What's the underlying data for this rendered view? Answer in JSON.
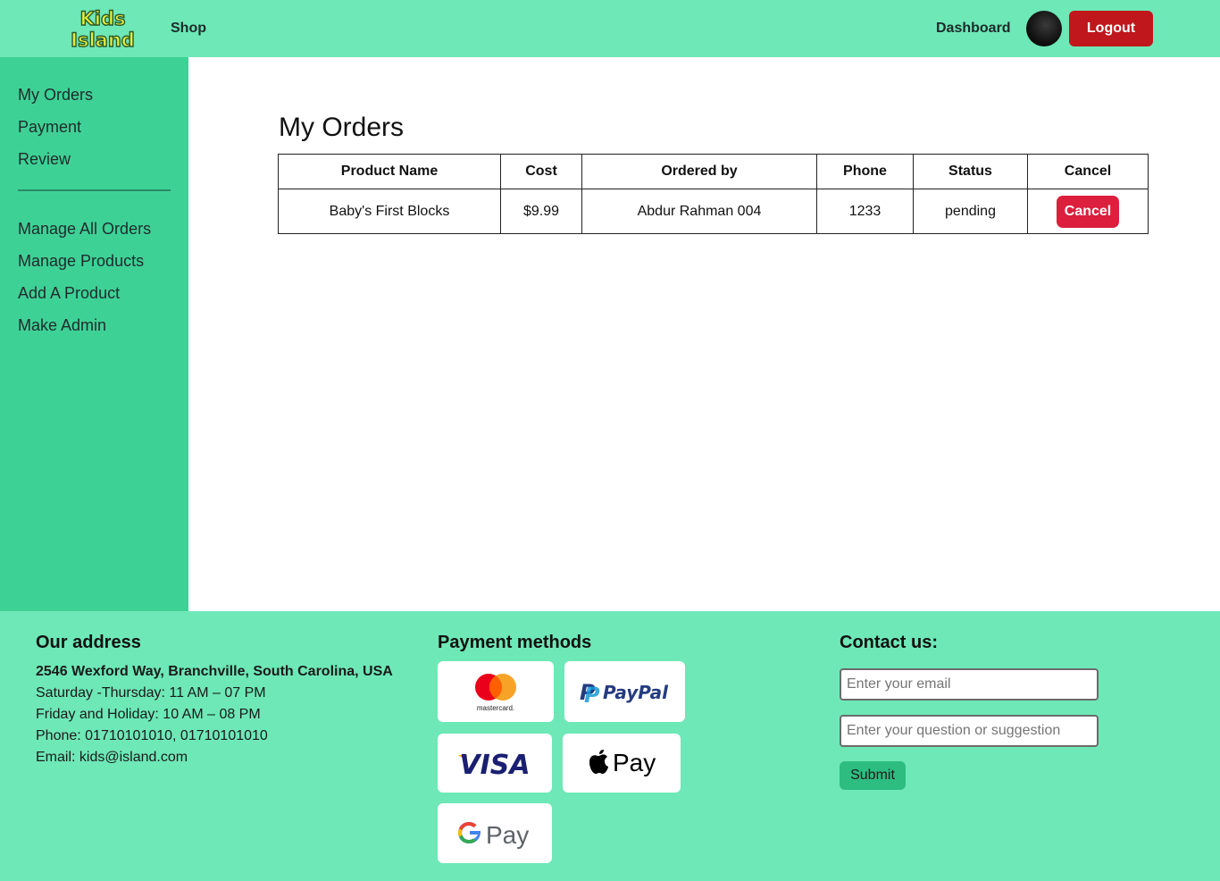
{
  "header": {
    "logo_line1": "Kids",
    "logo_line2": "Island",
    "shop_label": "Shop",
    "dashboard_label": "Dashboard",
    "logout_label": "Logout"
  },
  "sidebar": {
    "items": [
      {
        "label": "My Orders"
      },
      {
        "label": "Payment"
      },
      {
        "label": "Review"
      },
      {
        "label": "Manage All Orders"
      },
      {
        "label": "Manage Products"
      },
      {
        "label": "Add A Product"
      },
      {
        "label": "Make Admin"
      }
    ]
  },
  "main": {
    "title": "My Orders",
    "table": {
      "columns": [
        "Product Name",
        "Cost",
        "Ordered by",
        "Phone",
        "Status",
        "Cancel"
      ],
      "rows": [
        {
          "product": "Baby's First Blocks",
          "cost": "$9.99",
          "ordered_by": "Abdur Rahman 004",
          "phone": "1233",
          "status": "pending",
          "action": "Cancel"
        }
      ]
    }
  },
  "footer": {
    "address_title": "Our address",
    "address_lines": [
      "2546 Wexford Way, Branchville, South Carolina, USA",
      "Saturday -Thursday: 11 AM – 07 PM",
      "Friday and Holiday: 10 AM – 08 PM",
      "Phone: 01710101010, 01710101010",
      "Email: kids@island.com"
    ],
    "payment_title": "Payment methods",
    "payments": [
      {
        "name": "mastercard-icon",
        "label": "mastercard."
      },
      {
        "name": "paypal-icon",
        "label": "PayPal"
      },
      {
        "name": "visa-icon",
        "label": "VISA"
      },
      {
        "name": "apple-pay-icon",
        "label": "Pay"
      },
      {
        "name": "google-pay-icon",
        "label": "Pay"
      }
    ],
    "contact_title": "Contact us:",
    "email_placeholder": "Enter your email",
    "question_placeholder": "Enter your question or suggestion",
    "submit_label": "Submit"
  },
  "colors": {
    "header_bg": "#6ee8b7",
    "sidebar_bg": "#3ed196",
    "logout_bg": "#c0171c",
    "cancel_bg": "#dc1f3d",
    "submit_bg": "#2ebd80"
  }
}
